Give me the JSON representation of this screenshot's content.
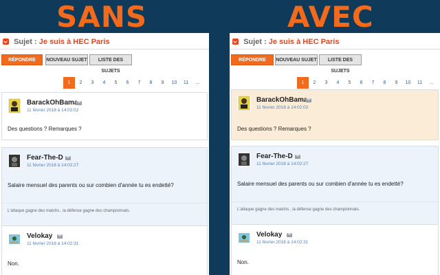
{
  "left": {
    "heading": "SANS",
    "subject": {
      "label": "Sujet :",
      "value": "Je suis à HEC Paris"
    },
    "buttons": {
      "reply": "RÉPONDRE",
      "new_topic": "NOUVEAU SUJET",
      "topic_list": "LISTE DES SUJETS"
    },
    "pagination": {
      "pages": [
        "1",
        "2",
        "3",
        "4",
        "5",
        "6",
        "7",
        "8",
        "9",
        "10",
        "11"
      ],
      "more": "...",
      "current": "1"
    },
    "posts": [
      {
        "user": "BarackOhBama",
        "date": "11 février 2018 à 14:02:02",
        "message": "Des questions ? Remarques ?"
      },
      {
        "user": "Fear-The-D",
        "date": "11 février 2018 à 14:02:27",
        "message": "Salaire mensuel des parents ou sur combien d'année tu es endetté?",
        "signature": "L'attaque gagne des matchs , la défense gagne des championnats."
      },
      {
        "user": "Velokay",
        "date": "11 février 2018 à 14:02:31",
        "message": "Non."
      }
    ]
  },
  "right": {
    "heading": "AVEC",
    "subject": {
      "label": "Sujet :",
      "value": "Je suis à HEC Paris"
    },
    "buttons": {
      "reply": "RÉPONDRE",
      "new_topic": "NOUVEAU SUJET",
      "topic_list": "LISTE DES SUJETS"
    },
    "pagination": {
      "pages": [
        "1",
        "2",
        "3",
        "4",
        "5",
        "6",
        "7",
        "8",
        "9",
        "10",
        "11"
      ],
      "more": "...",
      "current": "1"
    },
    "posts": [
      {
        "user": "BarackOhBama",
        "date": "11 février 2018 à 14:02:02",
        "message": "Des questions ? Remarques ?"
      },
      {
        "user": "Fear-The-D",
        "date": "11 février 2018 à 14:02:27",
        "message": "Salaire mensuel des parents ou sur combien d'année tu es endetté?",
        "signature": "L'attaque gagne des matchs , la défense gagne des championnats."
      },
      {
        "user": "Velokay",
        "date": "11 février 2018 à 14:02:31",
        "message": "Non."
      }
    ]
  },
  "colors": {
    "background": "#103a5a",
    "accent": "#f26a1b",
    "link": "#2c5aa0",
    "post_blue": "#ecf3fb",
    "post_beige": "#fbecd8"
  },
  "icons": {
    "subject_toggle": "chevron-down-icon",
    "envelope": "mail-icon"
  }
}
